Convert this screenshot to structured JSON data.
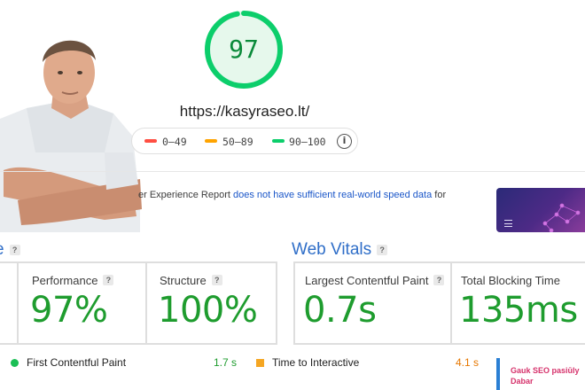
{
  "report": {
    "score": "97",
    "score_fraction": 0.97,
    "score_color": "#0cce6b",
    "url": "https://kasyraseo.lt/"
  },
  "legend": {
    "items": [
      {
        "label": "0–49",
        "color": "#ff4e42"
      },
      {
        "label": "50–89",
        "color": "#ffa400"
      },
      {
        "label": "90–100",
        "color": "#0cce6b"
      }
    ],
    "info_icon": "info-icon"
  },
  "crux": {
    "prefix": "er Experience Report ",
    "link": "does not have sufficient real-world speed data",
    "suffix": " for"
  },
  "grades": {
    "title_fragment": "e",
    "help": "?",
    "performance_label": "Performance",
    "performance_value": "97%",
    "structure_label": "Structure",
    "structure_value": "100%"
  },
  "web_vitals": {
    "title": "Web Vitals",
    "help": "?",
    "lcp_label": "Largest Contentful Paint",
    "lcp_value": "0.7s",
    "tbt_label": "Total Blocking Time",
    "tbt_value": "135ms"
  },
  "metrics": [
    {
      "name": "First Contentful Paint",
      "value": "1.7 s",
      "status_color": "#1bbf55"
    },
    {
      "name": "Time to Interactive",
      "value": "4.1 s",
      "status_color": "#e67700"
    }
  ],
  "side_card": {
    "text": "Gauk SEO pasiūly Dabar"
  },
  "thumbnail": {
    "menu_icon": "menu-icon"
  }
}
